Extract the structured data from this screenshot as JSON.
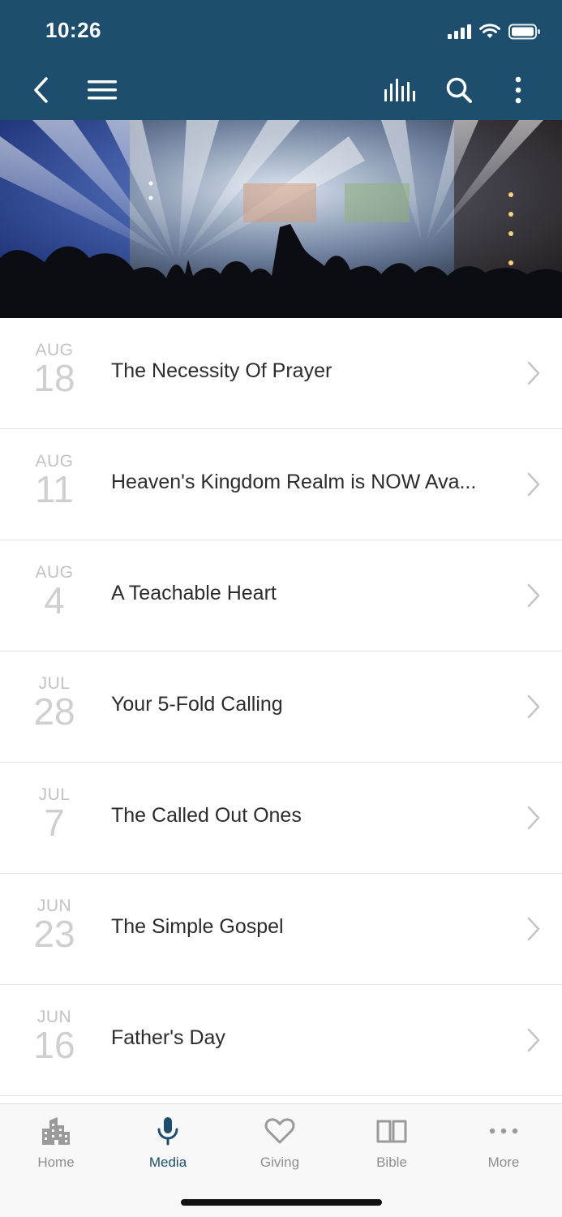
{
  "status_bar": {
    "time": "10:26"
  },
  "toolbar": {
    "back_icon": "chevron-left-icon",
    "menu_icon": "hamburger-menu-icon",
    "audio_icon": "audio-bars-icon",
    "search_icon": "search-icon",
    "more_icon": "vertical-dots-icon"
  },
  "colors": {
    "brand": "#1d4e6e",
    "date_gray": "#c2c2c2",
    "divider": "#e2e2e2"
  },
  "sermons": [
    {
      "month": "AUG",
      "day": "18",
      "title": "The Necessity Of Prayer"
    },
    {
      "month": "AUG",
      "day": "11",
      "title": "Heaven's Kingdom Realm is NOW Ava..."
    },
    {
      "month": "AUG",
      "day": "4",
      "title": "A Teachable Heart"
    },
    {
      "month": "JUL",
      "day": "28",
      "title": "Your 5-Fold Calling"
    },
    {
      "month": "JUL",
      "day": "7",
      "title": "The Called Out Ones"
    },
    {
      "month": "JUN",
      "day": "23",
      "title": "The Simple Gospel"
    },
    {
      "month": "JUN",
      "day": "16",
      "title": "Father's Day"
    }
  ],
  "tabs": [
    {
      "label": "Home",
      "icon": "building-icon"
    },
    {
      "label": "Media",
      "icon": "microphone-icon",
      "active": true
    },
    {
      "label": "Giving",
      "icon": "heart-icon"
    },
    {
      "label": "Bible",
      "icon": "book-icon"
    },
    {
      "label": "More",
      "icon": "horizontal-dots-icon"
    }
  ]
}
